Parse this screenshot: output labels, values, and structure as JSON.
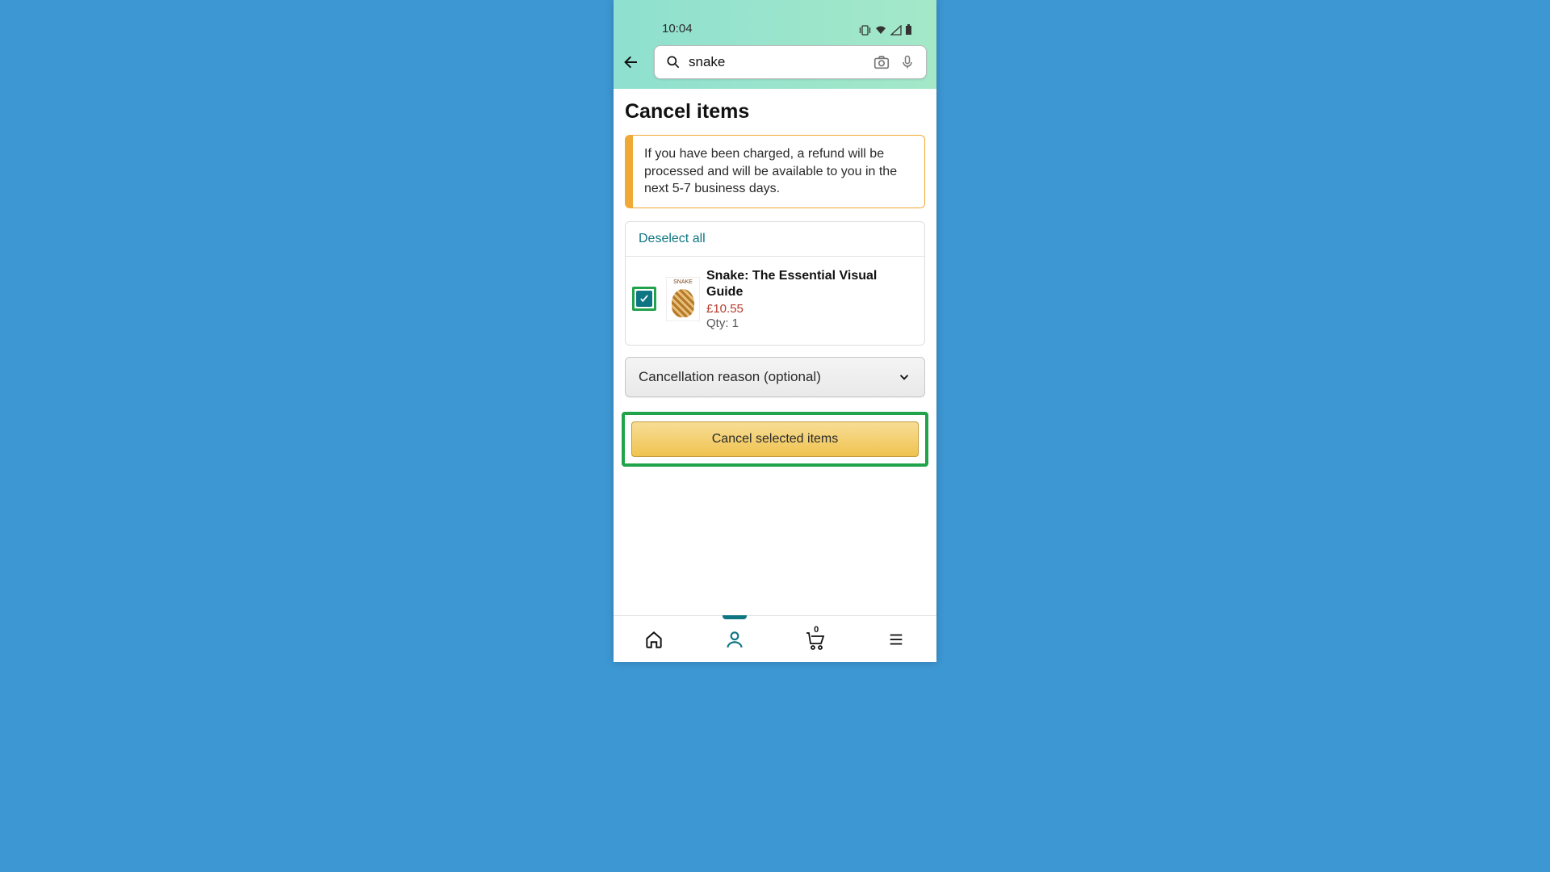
{
  "status": {
    "time": "10:04"
  },
  "search": {
    "value": "snake"
  },
  "page": {
    "title": "Cancel items"
  },
  "notice": {
    "text": "If you have been charged, a refund will be processed and will be available to you in the next 5-7 business days."
  },
  "list": {
    "deselect": "Deselect all"
  },
  "item": {
    "title": "Snake: The Essential Visual Guide",
    "price": "£10.55",
    "qty": "Qty: 1"
  },
  "dropdown": {
    "label": "Cancellation reason (optional)"
  },
  "action": {
    "cancel": "Cancel selected items"
  },
  "cart": {
    "count": "0"
  }
}
